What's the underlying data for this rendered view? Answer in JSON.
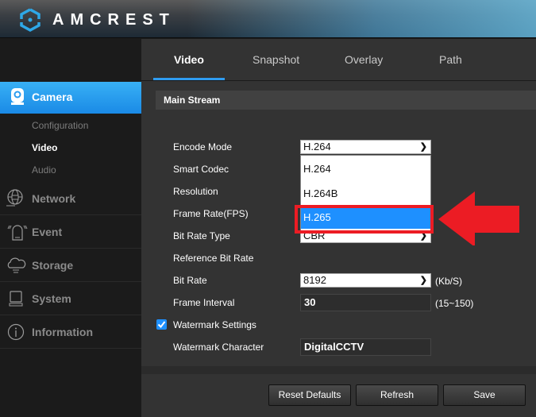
{
  "header": {
    "brand": "AMCREST"
  },
  "sidebar": {
    "active_section": "Camera",
    "camera_sub_items": [
      {
        "label": "Configuration",
        "active": false
      },
      {
        "label": "Video",
        "active": true
      },
      {
        "label": "Audio",
        "active": false
      }
    ],
    "items": [
      {
        "label": "Network",
        "icon": "globe-network-icon"
      },
      {
        "label": "Event",
        "icon": "alarm-event-icon"
      },
      {
        "label": "Storage",
        "icon": "cloud-storage-icon"
      },
      {
        "label": "System",
        "icon": "computer-system-icon"
      },
      {
        "label": "Information",
        "icon": "info-icon"
      }
    ]
  },
  "tabs": [
    {
      "label": "Video",
      "active": true
    },
    {
      "label": "Snapshot",
      "active": false
    },
    {
      "label": "Overlay",
      "active": false
    },
    {
      "label": "Path",
      "active": false
    }
  ],
  "section_title": "Main Stream",
  "form": {
    "encode_mode": {
      "label": "Encode Mode",
      "value": "H.264",
      "options": [
        "H.264",
        "H.264B",
        "H.265"
      ],
      "highlighted_option": "H.265"
    },
    "smart_codec": {
      "label": "Smart Codec"
    },
    "resolution": {
      "label": "Resolution"
    },
    "frame_rate": {
      "label": "Frame Rate(FPS)"
    },
    "bit_rate_type": {
      "label": "Bit Rate Type",
      "value": "CBR"
    },
    "reference_bit_rate": {
      "label": "Reference Bit Rate"
    },
    "bit_rate": {
      "label": "Bit Rate",
      "value": "8192",
      "unit": "(Kb/S)"
    },
    "frame_interval": {
      "label": "Frame Interval",
      "value": "30",
      "range": "(15~150)"
    },
    "watermark_settings": {
      "label": "Watermark Settings",
      "checked": true
    },
    "watermark_character": {
      "label": "Watermark Character",
      "value": "DigitalCCTV"
    }
  },
  "buttons": {
    "reset": "Reset Defaults",
    "refresh": "Refresh",
    "save": "Save"
  },
  "colors": {
    "accent": "#2f9cf0",
    "highlight_selected": "#1e90ff",
    "annotation_red": "#ec1c24"
  }
}
